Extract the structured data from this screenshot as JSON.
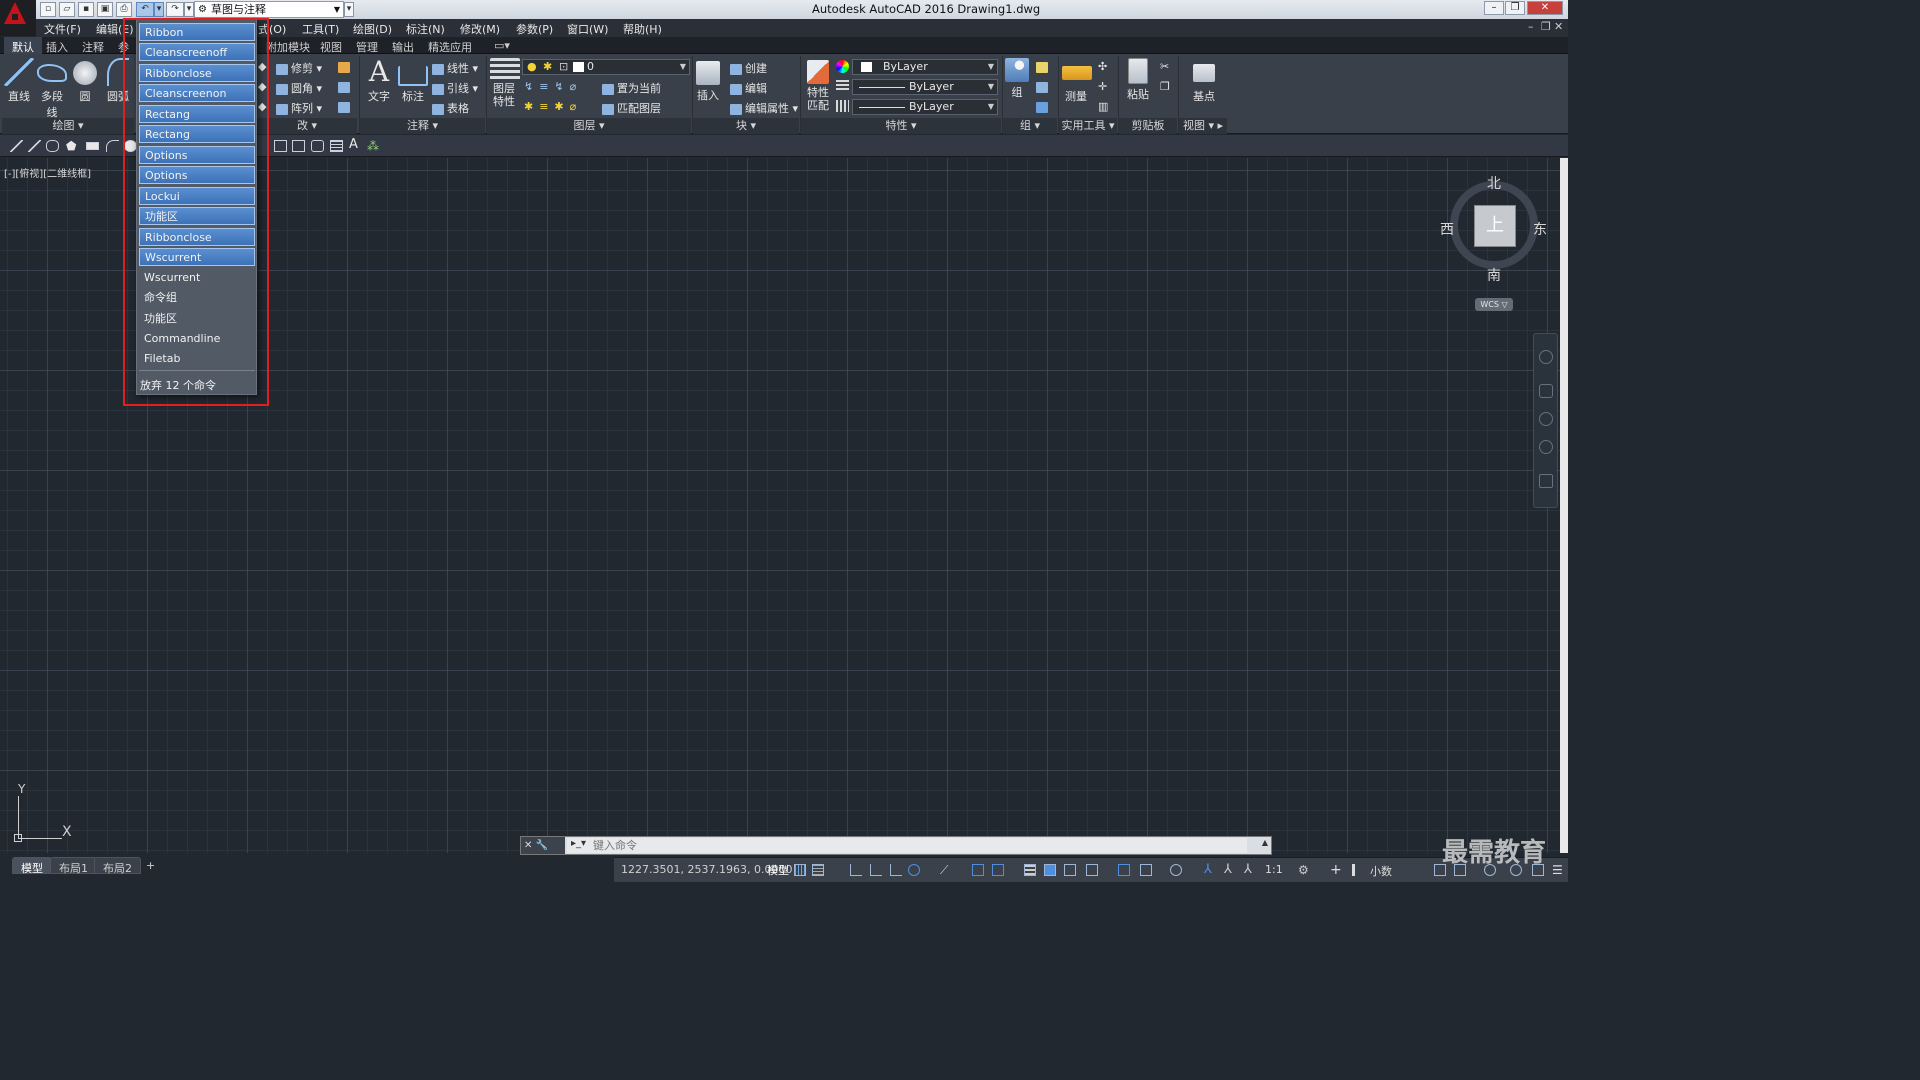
{
  "titlebar": {
    "window_title": "Autodesk AutoCAD 2016    Drawing1.dwg",
    "workspace": "草图与注释"
  },
  "menubar": {
    "items": [
      "文件(F)",
      "编辑(E)",
      "式(O)",
      "工具(T)",
      "绘图(D)",
      "标注(N)",
      "修改(M)",
      "参数(P)",
      "窗口(W)",
      "帮助(H)"
    ]
  },
  "ribbon_tabs": [
    "默认",
    "插入",
    "注释",
    "参",
    "附加模块",
    "视图",
    "管理",
    "输出",
    "精选应用"
  ],
  "ribbon": {
    "draw": {
      "title": "绘图",
      "line": "直线",
      "polyline": "多段线",
      "circle": "圆",
      "arc": "圆弧"
    },
    "modify": {
      "title": "改",
      "trim": "修剪",
      "fillet": "圆角",
      "array": "阵列"
    },
    "annotation": {
      "title": "注释",
      "text": "文字",
      "dimension": "标注",
      "linear": "线性",
      "leader": "引线",
      "table": "表格"
    },
    "layers": {
      "title": "图层",
      "properties": "图层\n特性",
      "current_layer": "0",
      "set_current": "置为当前",
      "match_layer": "匹配图层"
    },
    "block": {
      "title": "块",
      "insert": "插入",
      "create": "创建",
      "edit": "编辑",
      "edit_attr": "编辑属性"
    },
    "properties": {
      "title": "特性",
      "match": "特性\n匹配",
      "color": "ByLayer",
      "linetype": "ByLayer",
      "lineweight": "ByLayer"
    },
    "groups": {
      "title": "组",
      "group": "组"
    },
    "utilities": {
      "title": "实用工具",
      "measure": "测量"
    },
    "clipboard": {
      "title": "剪贴板",
      "paste": "粘贴"
    },
    "view": {
      "title": "视图",
      "base": "基点"
    }
  },
  "viewport": {
    "label": "[-][俯视][二维线框]"
  },
  "viewcube": {
    "north": "北",
    "south": "南",
    "east": "东",
    "west": "西",
    "face": "上",
    "wcs": "WCS"
  },
  "ucs": {
    "x": "X",
    "y": "Y"
  },
  "undo_menu": {
    "items": [
      {
        "label": "Ribbon",
        "selected": true
      },
      {
        "label": "Cleanscreenoff",
        "selected": true
      },
      {
        "label": "Ribbonclose",
        "selected": true
      },
      {
        "label": "Cleanscreenon",
        "selected": true
      },
      {
        "label": "Rectang",
        "selected": true
      },
      {
        "label": "Rectang",
        "selected": true
      },
      {
        "label": "Options",
        "selected": true
      },
      {
        "label": "Options",
        "selected": true
      },
      {
        "label": "Lockui",
        "selected": true
      },
      {
        "label": "功能区",
        "selected": true
      },
      {
        "label": "Ribbonclose",
        "selected": true
      },
      {
        "label": "Wscurrent",
        "selected": true
      },
      {
        "label": "Wscurrent",
        "selected": false
      },
      {
        "label": "命令组",
        "selected": false
      },
      {
        "label": "功能区",
        "selected": false
      },
      {
        "label": "Commandline",
        "selected": false
      },
      {
        "label": "Filetab",
        "selected": false
      }
    ],
    "footer": "放弃 12 个命令"
  },
  "commandline": {
    "placeholder": "键入命令"
  },
  "layout_tabs": [
    "模型",
    "布局1",
    "布局2",
    "+"
  ],
  "statusbar": {
    "coords": "1227.3501, 2537.1963, 0.0000",
    "model": "模型",
    "scale": "1:1",
    "units": "小数"
  },
  "watermark": "最需教育"
}
